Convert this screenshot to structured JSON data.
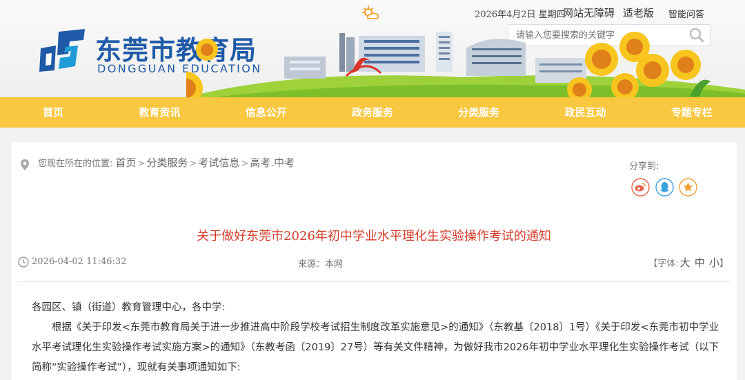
{
  "topbar": {
    "weather_icon": "sun-cloud-icon",
    "date": "2026年4月2日 星期四",
    "links": [
      "网站无障碍",
      "适老版",
      "智能问答"
    ]
  },
  "search": {
    "placeholder": "请输入您要搜索的关键字",
    "icon": "search-icon"
  },
  "logo": {
    "cn": "东莞市教育局",
    "en": "DONGGUAN EDUCATION"
  },
  "nav": [
    "首页",
    "教育资讯",
    "信息公开",
    "政务服务",
    "分类服务",
    "政民互动",
    "专题专栏"
  ],
  "breadcrumb": {
    "prefix": "您现在所在的位置:",
    "items": [
      "首页",
      "分类服务",
      "考试信息",
      "高考.中考"
    ]
  },
  "share": {
    "label": "分享到:",
    "icons": [
      "weibo-icon",
      "qq-icon",
      "favorite-star-icon"
    ]
  },
  "article": {
    "title": "关于做好东莞市2026年初中学业水平理化生实验操作考试的通知",
    "date": "2026-04-02 11:46:32",
    "source": "来源：本网",
    "fontsize_label": "【字体:",
    "fontsize_options": [
      "大",
      "中",
      "小"
    ],
    "fontsize_close": "】",
    "greeting": "各园区、镇（街道）教育管理中心，各中学:",
    "paragraph": "根据《关于印发<东莞市教育局关于进一步推进高中阶段学校考试招生制度改革实施意见>的通知》（东教基〔2018〕1号）《关于印发<东莞市初中学业水平考试理化生实验操作考试实施方案>的通知》（东教考函〔2019〕27号）等有关文件精神，为做好我市2026年初中学业水平理化生实验操作考试（以下简称“实验操作考试”），现就有关事项通知如下:"
  },
  "colors": {
    "nav_bg": "#f9c740",
    "brand_blue": "#1f5aa8",
    "title_red": "#d43d2a"
  }
}
